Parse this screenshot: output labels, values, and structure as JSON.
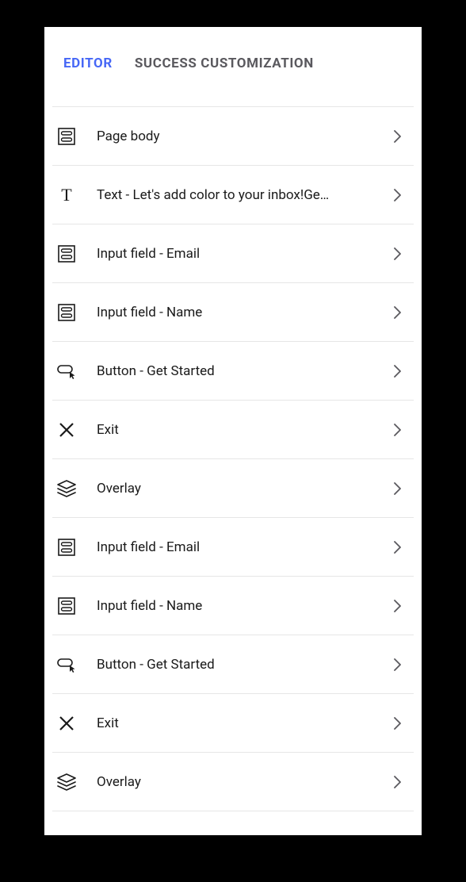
{
  "tabs": {
    "editor": "EDITOR",
    "success": "SUCCESS CUSTOMIZATION",
    "active": "editor"
  },
  "items": [
    {
      "icon": "layout",
      "label": "Page body"
    },
    {
      "icon": "text",
      "label": "Text - Let's add color to your inbox!Ge…"
    },
    {
      "icon": "layout",
      "label": "Input field - Email"
    },
    {
      "icon": "layout",
      "label": "Input field - Name"
    },
    {
      "icon": "button",
      "label": "Button - Get Started"
    },
    {
      "icon": "close",
      "label": "Exit"
    },
    {
      "icon": "layers",
      "label": "Overlay"
    },
    {
      "icon": "layout",
      "label": "Input field - Email"
    },
    {
      "icon": "layout",
      "label": "Input field - Name"
    },
    {
      "icon": "button",
      "label": "Button - Get Started"
    },
    {
      "icon": "close",
      "label": "Exit"
    },
    {
      "icon": "layers",
      "label": "Overlay"
    }
  ]
}
